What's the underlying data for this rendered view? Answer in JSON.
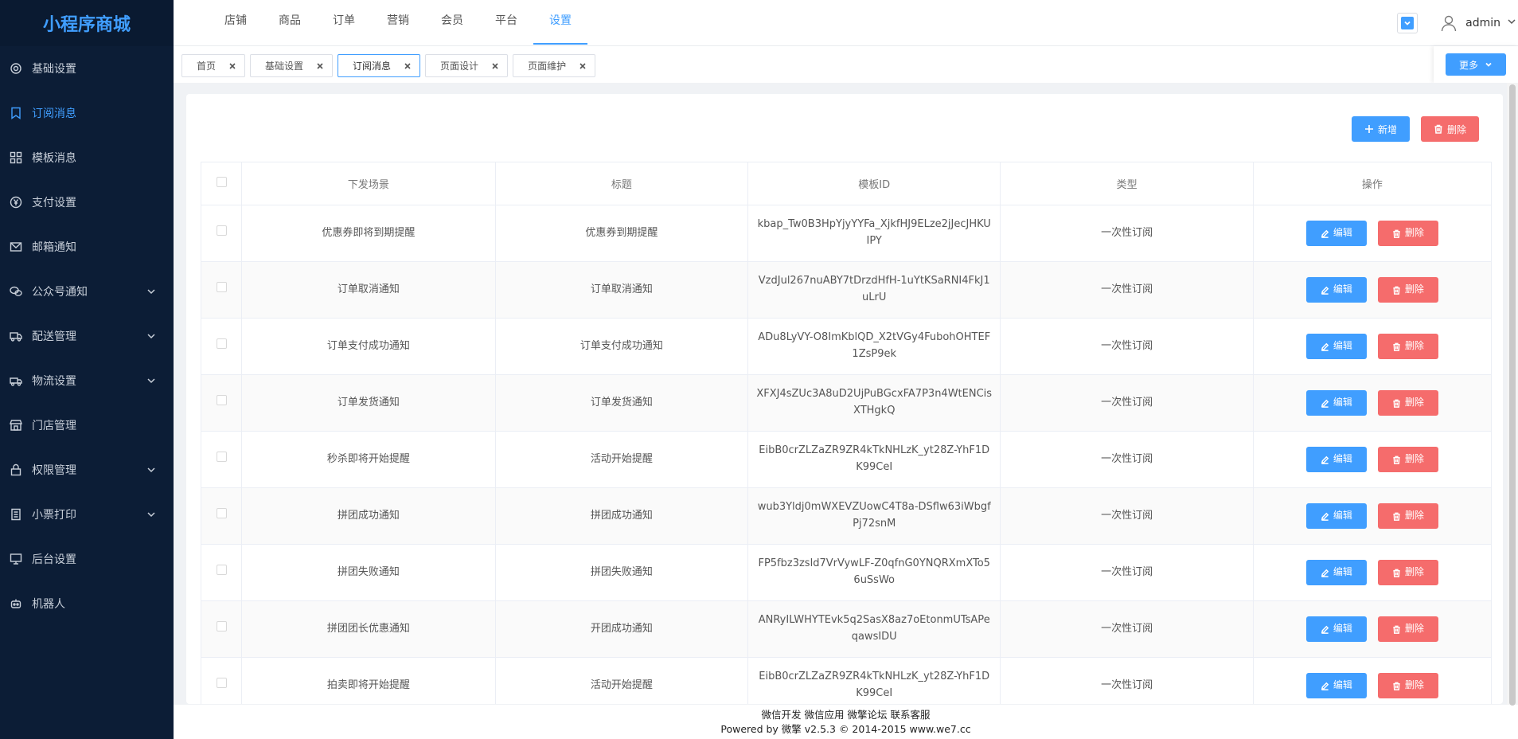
{
  "app": {
    "title": "小程序商城"
  },
  "sidebar": {
    "items": [
      {
        "label": "基础设置",
        "icon": "gear-icon",
        "active": false,
        "has_arrow": false
      },
      {
        "label": "订阅消息",
        "icon": "bookmark-icon",
        "active": true,
        "has_arrow": false
      },
      {
        "label": "模板消息",
        "icon": "grid-icon",
        "active": false,
        "has_arrow": false
      },
      {
        "label": "支付设置",
        "icon": "yen-circle-icon",
        "active": false,
        "has_arrow": false
      },
      {
        "label": "邮箱通知",
        "icon": "mail-icon",
        "active": false,
        "has_arrow": false
      },
      {
        "label": "公众号通知",
        "icon": "wechat-icon",
        "active": false,
        "has_arrow": true
      },
      {
        "label": "配送管理",
        "icon": "truck-icon",
        "active": false,
        "has_arrow": true
      },
      {
        "label": "物流设置",
        "icon": "van-icon",
        "active": false,
        "has_arrow": true
      },
      {
        "label": "门店管理",
        "icon": "store-icon",
        "active": false,
        "has_arrow": false
      },
      {
        "label": "权限管理",
        "icon": "lock-icon",
        "active": false,
        "has_arrow": true
      },
      {
        "label": "小票打印",
        "icon": "receipt-icon",
        "active": false,
        "has_arrow": true
      },
      {
        "label": "后台设置",
        "icon": "monitor-icon",
        "active": false,
        "has_arrow": false
      },
      {
        "label": "机器人",
        "icon": "robot-icon",
        "active": false,
        "has_arrow": false
      }
    ]
  },
  "topnav": {
    "items": [
      {
        "label": "店铺",
        "active": false
      },
      {
        "label": "商品",
        "active": false
      },
      {
        "label": "订单",
        "active": false
      },
      {
        "label": "营销",
        "active": false
      },
      {
        "label": "会员",
        "active": false
      },
      {
        "label": "平台",
        "active": false
      },
      {
        "label": "设置",
        "active": true
      }
    ],
    "user": "admin"
  },
  "tabs": {
    "items": [
      {
        "label": "首页",
        "active": false
      },
      {
        "label": "基础设置",
        "active": false
      },
      {
        "label": "订阅消息",
        "active": true
      },
      {
        "label": "页面设计",
        "active": false
      },
      {
        "label": "页面维护",
        "active": false
      }
    ],
    "more_label": "更多"
  },
  "toolbar": {
    "add_label": "新增",
    "delete_label": "删除"
  },
  "table": {
    "headers": [
      "下发场景",
      "标题",
      "模板ID",
      "类型",
      "操作"
    ],
    "edit_label": "编辑",
    "delete_label": "删除",
    "rows": [
      {
        "scene": "优惠券即将到期提醒",
        "title": "优惠券到期提醒",
        "template_id": "kbap_Tw0B3HpYjyYYFa_XjkfHJ9ELze2jJecJHKUIPY",
        "type": "一次性订阅"
      },
      {
        "scene": "订单取消通知",
        "title": "订单取消通知",
        "template_id": "VzdJul267nuABY7tDrzdHfH-1uYtKSaRNI4FkJ1uLrU",
        "type": "一次性订阅"
      },
      {
        "scene": "订单支付成功通知",
        "title": "订单支付成功通知",
        "template_id": "ADu8LyVY-O8ImKblQD_X2tVGy4FubohOHTEF1ZsP9ek",
        "type": "一次性订阅"
      },
      {
        "scene": "订单发货通知",
        "title": "订单发货通知",
        "template_id": "XFXJ4sZUc3A8uD2UjPuBGcxFA7P3n4WtENCisXTHgkQ",
        "type": "一次性订阅"
      },
      {
        "scene": "秒杀即将开始提醒",
        "title": "活动开始提醒",
        "template_id": "EibB0crZLZaZR9ZR4kTkNHLzK_yt28Z-YhF1DK99CeI",
        "type": "一次性订阅"
      },
      {
        "scene": "拼团成功通知",
        "title": "拼团成功通知",
        "template_id": "wub3Yldj0mWXEVZUowC4T8a-DSflw63iWbgfPj72snM",
        "type": "一次性订阅"
      },
      {
        "scene": "拼团失败通知",
        "title": "拼团失败通知",
        "template_id": "FP5fbz3zsld7VrVywLF-Z0qfnG0YNQRXmXTo56uSsWo",
        "type": "一次性订阅"
      },
      {
        "scene": "拼团团长优惠通知",
        "title": "开团成功通知",
        "template_id": "ANRyILWHYTEvk5q2SasX8az7oEtonmUTsAPeqawsIDU",
        "type": "一次性订阅"
      },
      {
        "scene": "拍卖即将开始提醒",
        "title": "活动开始提醒",
        "template_id": "EibB0crZLZaZR9ZR4kTkNHLzK_yt28Z-YhF1DK99CeI",
        "type": "一次性订阅"
      }
    ]
  },
  "footer": {
    "links": "微信开发 微信应用 微擎论坛 联系客服",
    "powered": "Powered by 微擎 v2.5.3 © 2014-2015 www.we7.cc"
  },
  "colors": {
    "primary": "#409eff",
    "danger": "#f56c6c",
    "sidebar_bg": "#0c1d36"
  }
}
